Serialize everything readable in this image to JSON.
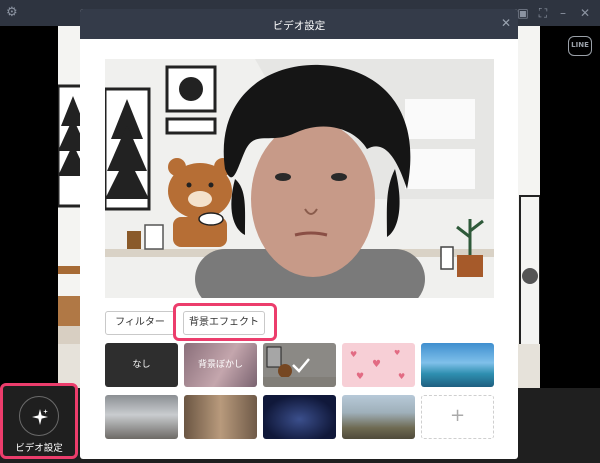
{
  "window": {
    "title": "",
    "logo": "LINE"
  },
  "dialog": {
    "title": "ビデオ設定",
    "close_icon": "close-icon"
  },
  "tabs": {
    "filter_label": "フィルター",
    "background_label": "背景エフェクト",
    "selected": "background"
  },
  "thumbnails": {
    "none_label": "なし",
    "blur_label": "背景ぼかし",
    "selected_index": 2,
    "add_icon": "+"
  },
  "bottom": {
    "video_settings_label": "ビデオ設定",
    "video_settings_icon": "sparkle-icon"
  },
  "colors": {
    "highlight": "#ec3d6c",
    "dialog_header": "#343b49",
    "titlebar": "#2e3440"
  }
}
